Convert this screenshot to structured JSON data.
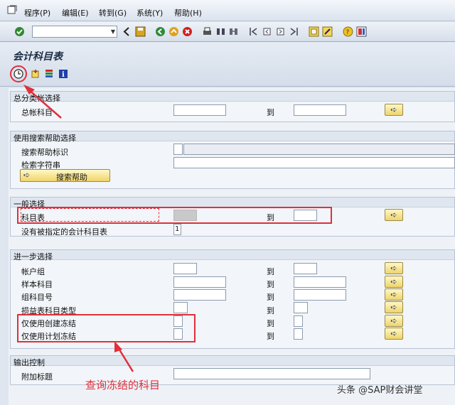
{
  "menu": {
    "items": [
      {
        "label": "程序(P)"
      },
      {
        "label": "编辑(E)"
      },
      {
        "label": "转到(G)"
      },
      {
        "label": "系统(Y)"
      },
      {
        "label": "帮助(H)"
      }
    ]
  },
  "toolbar": {
    "command_value": "",
    "icons": [
      "check-icon",
      "back-icon",
      "save-icon",
      "nav-back-icon",
      "exit-icon",
      "cancel-icon",
      "print-icon",
      "find-icon",
      "find-next-icon",
      "first-page-icon",
      "prev-page-icon",
      "next-page-icon",
      "last-page-icon",
      "new-session-icon",
      "shortcut-icon",
      "help-icon",
      "layout-icon"
    ]
  },
  "title": "会计科目表",
  "app_toolbar": {
    "icons": [
      "execute-icon",
      "variant-icon",
      "selection-options-icon",
      "info-icon"
    ]
  },
  "groups": {
    "gl_selection": {
      "title": "总分类帐选择",
      "account_label": "总帐科目",
      "to_label": "到"
    },
    "search_help": {
      "title": "使用搜索帮助选择",
      "id_label": "搜索帮助标识",
      "search_string_label": "检索字符串",
      "button_label": "搜索帮助"
    },
    "general": {
      "title": "一般选择",
      "coa_label": "科目表",
      "to_label": "到",
      "unassigned_label": "没有被指定的会计科目表",
      "unassigned_value": "1"
    },
    "further": {
      "title": "进一步选择",
      "rows": [
        {
          "label": "帐户组",
          "to": "到"
        },
        {
          "label": "样本科目",
          "to": "到"
        },
        {
          "label": "组科目号",
          "to": "到"
        },
        {
          "label": "损益表科目类型",
          "to": "到"
        },
        {
          "label": "仅使用创建冻结",
          "to": "到"
        },
        {
          "label": "仅使用计划冻结",
          "to": "到"
        }
      ]
    },
    "output": {
      "title": "输出控制",
      "heading_label": "附加标题"
    }
  },
  "annotation": "查询冻结的科目",
  "watermark": "头条 @SAP财会讲堂",
  "colors": {
    "accent_red": "#e0303a",
    "button_yellow": "#f0d46a"
  }
}
